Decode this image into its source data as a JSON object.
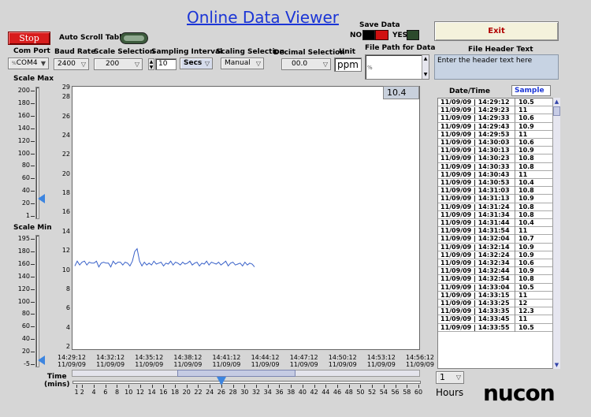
{
  "title": "Online  Data Viewer",
  "controls": {
    "stop_label": "Stop",
    "auto_scroll_label": "Auto Scroll Table",
    "com_port_label": "Com Port",
    "com_port_value": "COM4",
    "baud_rate_label": "Baud Rate",
    "baud_rate_value": "2400",
    "scale_selection_label": "Scale Selection",
    "scale_selection_value": "200",
    "sampling_interval_label": "Sampling Interval",
    "sampling_interval_value": "10",
    "sampling_unit": "Secs",
    "scaling_selection_label": "Scaling Selection",
    "scaling_selection_value": "Manual",
    "decimal_selection_label": "Decimal Selection",
    "decimal_selection_value": "00.0",
    "unit_label": "Unit",
    "unit_value": "ppm",
    "save_data_label": "Save Data",
    "no_label": "NO",
    "yes_label": "YES",
    "file_path_label": "File Path for Data",
    "exit_label": "Exit",
    "file_header_label": "File Header Text",
    "file_header_value": "Enter the header text here",
    "scale_max_label": "Scale Max",
    "scale_min_label": "Scale Min",
    "time_label": "Time\n(mins)",
    "hours_value": "1",
    "hours_label": "Hours",
    "current_value": "10.4",
    "logo_text": "nucon"
  },
  "scale_max_ticks": [
    "200",
    "180",
    "160",
    "140",
    "120",
    "100",
    "80",
    "60",
    "40",
    "20",
    "1"
  ],
  "scale_min_ticks": [
    "195",
    "180",
    "160",
    "140",
    "120",
    "100",
    "80",
    "60",
    "40",
    "20",
    "-5"
  ],
  "time_slider_ticks": [
    "1",
    "2",
    "4",
    "6",
    "8",
    "10",
    "12",
    "14",
    "16",
    "18",
    "20",
    "22",
    "24",
    "26",
    "28",
    "30",
    "32",
    "34",
    "36",
    "38",
    "40",
    "42",
    "44",
    "46",
    "48",
    "50",
    "52",
    "54",
    "56",
    "58",
    "60"
  ],
  "time_slider_value": 26,
  "chart_data": {
    "type": "line",
    "title": "",
    "xlabel": "",
    "ylabel": "",
    "ylim": [
      2,
      29
    ],
    "y_ticks": [
      2,
      4,
      6,
      8,
      10,
      12,
      14,
      16,
      18,
      20,
      22,
      24,
      26,
      28,
      29
    ],
    "x_ticks": [
      {
        "time": "14:29:12",
        "date": "11/09/09"
      },
      {
        "time": "14:32:12",
        "date": "11/09/09"
      },
      {
        "time": "14:35:12",
        "date": "11/09/09"
      },
      {
        "time": "14:38:12",
        "date": "11/09/09"
      },
      {
        "time": "14:41:12",
        "date": "11/09/09"
      },
      {
        "time": "14:44:12",
        "date": "11/09/09"
      },
      {
        "time": "14:47:12",
        "date": "11/09/09"
      },
      {
        "time": "14:50:12",
        "date": "11/09/09"
      },
      {
        "time": "14:53:12",
        "date": "11/09/09"
      },
      {
        "time": "14:56:12",
        "date": "11/09/09"
      }
    ],
    "series": [
      {
        "values": [
          10.5,
          11,
          10.6,
          10.9,
          11,
          10.6,
          10.9,
          10.8,
          10.8,
          11,
          10.4,
          10.8,
          10.9,
          10.8,
          10.8,
          10.4,
          11,
          10.7,
          10.9,
          10.9,
          10.6,
          10.9,
          10.8,
          10.5,
          11,
          12,
          12.3,
          11,
          10.5,
          10.9,
          10.6,
          10.8,
          10.6,
          11,
          10.7,
          10.8,
          10.9,
          10.5,
          10.8,
          10.7,
          11,
          10.6,
          10.9,
          10.8,
          10.6,
          10.9,
          10.7,
          10.8,
          11,
          10.6,
          10.8,
          10.9,
          10.5,
          10.8,
          10.7,
          11,
          10.6,
          10.9,
          10.8,
          10.7,
          10.9,
          10.6,
          10.8,
          11,
          10.5,
          10.8,
          10.9,
          10.6,
          10.7,
          10.8,
          10.5,
          10.9,
          10.6,
          10.8,
          10.7,
          10.4
        ],
        "color": "#3a62c9"
      }
    ]
  },
  "table": {
    "headers": [
      "Date/Time",
      "Sample"
    ],
    "rows": [
      [
        "11/09/09 | 14:29:12",
        "10.5"
      ],
      [
        "11/09/09 | 14:29:23",
        "11"
      ],
      [
        "11/09/09 | 14:29:33",
        "10.6"
      ],
      [
        "11/09/09 | 14:29:43",
        "10.9"
      ],
      [
        "11/09/09 | 14:29:53",
        "11"
      ],
      [
        "11/09/09 | 14:30:03",
        "10.6"
      ],
      [
        "11/09/09 | 14:30:13",
        "10.9"
      ],
      [
        "11/09/09 | 14:30:23",
        "10.8"
      ],
      [
        "11/09/09 | 14:30:33",
        "10.8"
      ],
      [
        "11/09/09 | 14:30:43",
        "11"
      ],
      [
        "11/09/09 | 14:30:53",
        "10.4"
      ],
      [
        "11/09/09 | 14:31:03",
        "10.8"
      ],
      [
        "11/09/09 | 14:31:13",
        "10.9"
      ],
      [
        "11/09/09 | 14:31:24",
        "10.8"
      ],
      [
        "11/09/09 | 14:31:34",
        "10.8"
      ],
      [
        "11/09/09 | 14:31:44",
        "10.4"
      ],
      [
        "11/09/09 | 14:31:54",
        "11"
      ],
      [
        "11/09/09 | 14:32:04",
        "10.7"
      ],
      [
        "11/09/09 | 14:32:14",
        "10.9"
      ],
      [
        "11/09/09 | 14:32:24",
        "10.9"
      ],
      [
        "11/09/09 | 14:32:34",
        "10.6"
      ],
      [
        "11/09/09 | 14:32:44",
        "10.9"
      ],
      [
        "11/09/09 | 14:32:54",
        "10.8"
      ],
      [
        "11/09/09 | 14:33:04",
        "10.5"
      ],
      [
        "11/09/09 | 14:33:15",
        "11"
      ],
      [
        "11/09/09 | 14:33:25",
        "12"
      ],
      [
        "11/09/09 | 14:33:35",
        "12.3"
      ],
      [
        "11/09/09 | 14:33:45",
        "11"
      ],
      [
        "11/09/09 | 14:33:55",
        "10.5"
      ]
    ]
  },
  "colors": {
    "title": "#1b35d6",
    "stop": "#d81c1c",
    "exit_text": "#b00000",
    "trace": "#3a62c9",
    "slider_thumb": "#3d85e0"
  },
  "icons": {
    "scroll_up": "triangle-up",
    "scroll_down": "triangle-down",
    "ring_arrow": "triangle-down"
  }
}
